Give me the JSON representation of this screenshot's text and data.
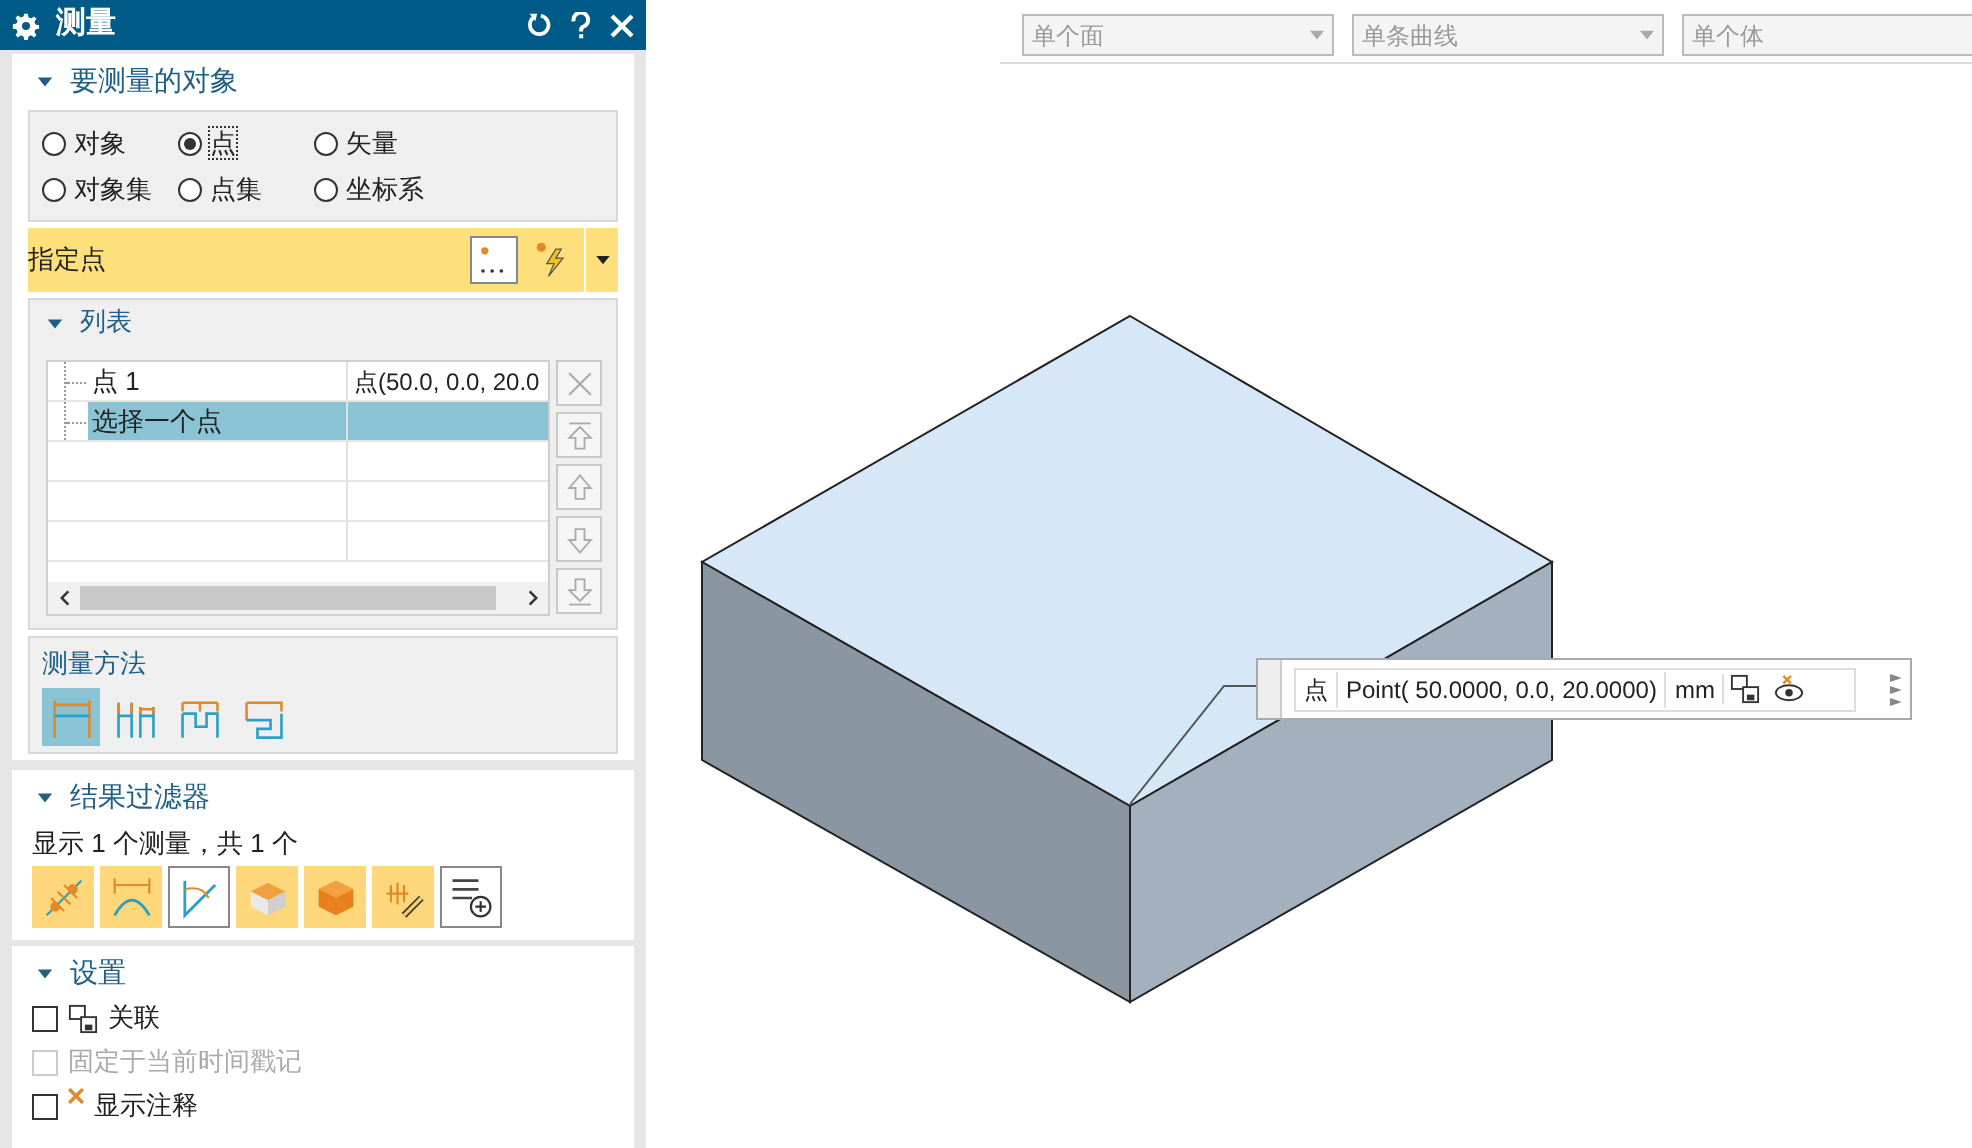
{
  "window": {
    "title": "测量"
  },
  "object_section": {
    "title": "要测量的对象",
    "expanded": true,
    "radios": [
      {
        "label": "对象",
        "selected": false
      },
      {
        "label": "点",
        "selected": true
      },
      {
        "label": "矢量",
        "selected": false
      },
      {
        "label": "对象集",
        "selected": false
      },
      {
        "label": "点集",
        "selected": false
      },
      {
        "label": "坐标系",
        "selected": false
      }
    ],
    "specify_point": {
      "label": "指定点"
    },
    "list": {
      "title": "列表",
      "expanded": true,
      "rows": [
        {
          "name": "点 1",
          "value": "点(50.0, 0.0, 20.0",
          "selected": false
        },
        {
          "name": "选择一个点",
          "value": "",
          "selected": true
        }
      ]
    },
    "method": {
      "title": "测量方法",
      "options": [
        {
          "selected": true
        },
        {
          "selected": false
        },
        {
          "selected": false
        },
        {
          "selected": false
        }
      ]
    }
  },
  "filter_section": {
    "title": "结果过滤器",
    "expanded": true,
    "summary": "显示 1 个测量，共 1 个",
    "filters": [
      {
        "on": true
      },
      {
        "on": true
      },
      {
        "on": false
      },
      {
        "on": true
      },
      {
        "on": true
      },
      {
        "on": true
      },
      {
        "on": false
      }
    ]
  },
  "settings_section": {
    "title": "设置",
    "expanded": true,
    "options": [
      {
        "label": "关联",
        "checked": false,
        "disabled": false,
        "kind": "associative"
      },
      {
        "label": "固定于当前时间戳记",
        "checked": false,
        "disabled": true,
        "kind": "plain"
      },
      {
        "label": "显示注释",
        "checked": false,
        "disabled": false,
        "kind": "annotation"
      }
    ]
  },
  "toolbar": {
    "dropdowns": [
      {
        "value": "单个面"
      },
      {
        "value": "单条曲线"
      },
      {
        "value": "单个体"
      }
    ]
  },
  "annotation": {
    "label": "点",
    "value": "Point( 50.0000, 0.0, 20.0000)",
    "unit": "mm"
  }
}
